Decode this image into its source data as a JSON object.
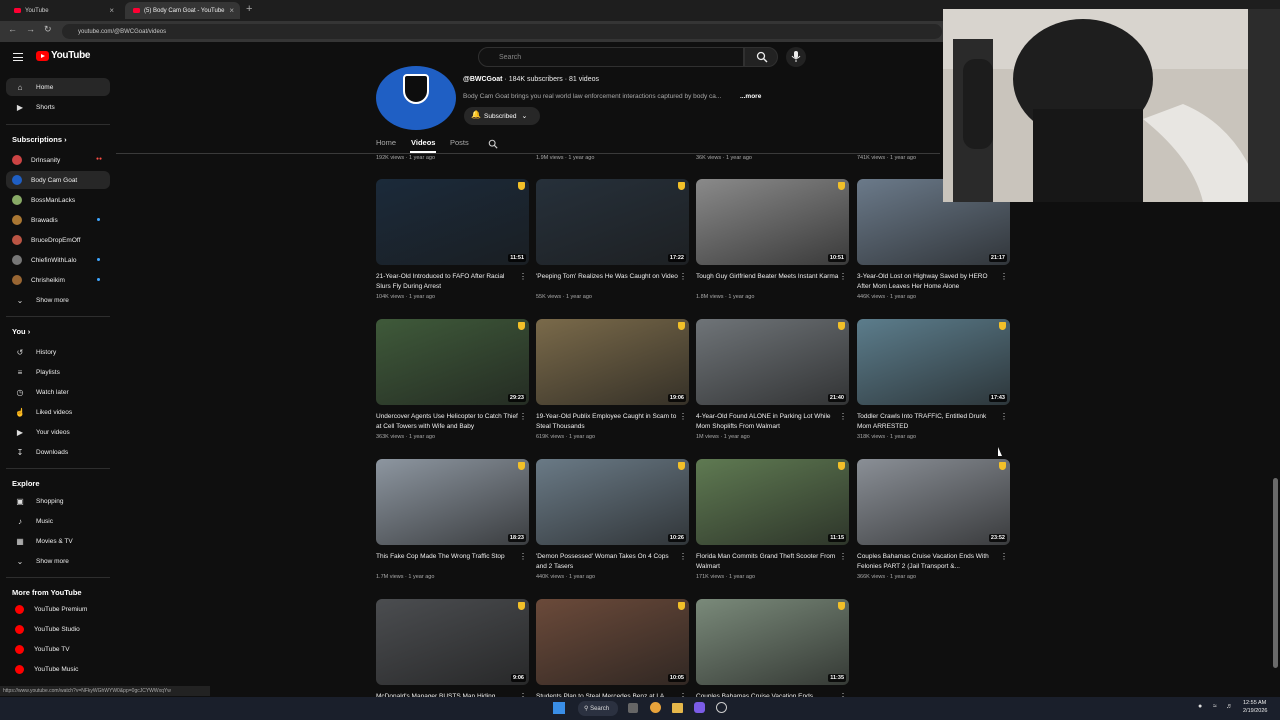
{
  "browser": {
    "tabs": [
      {
        "label": "YouTube",
        "close": "×"
      },
      {
        "label": "(5) Body Cam Goat - YouTube",
        "close": "×"
      }
    ],
    "new_tab": "+",
    "url": "youtube.com/@BWCGoat/videos",
    "status_url": "https://www.youtube.com/watch?v=NFkyWGhWYW0&pp=0gcJCYWWxqYw"
  },
  "header": {
    "logo": "YouTube",
    "search_placeholder": "Search"
  },
  "sidebar": {
    "main": [
      {
        "label": "Home",
        "icon": "home-icon"
      },
      {
        "label": "Shorts",
        "icon": "shorts-icon"
      }
    ],
    "subscriptions_title": "Subscriptions",
    "subscriptions": [
      {
        "label": "DrInsanity",
        "color": "#c44",
        "badge": "live"
      },
      {
        "label": "Body Cam Goat",
        "color": "#1f5fc4",
        "badge": "",
        "active": true
      },
      {
        "label": "BossManLacks",
        "color": "#8a6",
        "badge": ""
      },
      {
        "label": "Brawadis",
        "color": "#a73",
        "badge": "dot"
      },
      {
        "label": "BruceDropEmOff",
        "color": "#b54",
        "badge": ""
      },
      {
        "label": "ChiefinWithLalo",
        "color": "#777",
        "badge": "dot"
      },
      {
        "label": "Chrisheikim",
        "color": "#963",
        "badge": "dot"
      }
    ],
    "show_more": "Show more",
    "you_title": "You",
    "you": [
      {
        "label": "History",
        "icon": "history-icon"
      },
      {
        "label": "Playlists",
        "icon": "playlists-icon"
      },
      {
        "label": "Watch later",
        "icon": "watch-later-icon"
      },
      {
        "label": "Liked videos",
        "icon": "liked-icon"
      },
      {
        "label": "Your videos",
        "icon": "your-videos-icon"
      },
      {
        "label": "Downloads",
        "icon": "downloads-icon"
      }
    ],
    "explore_title": "Explore",
    "explore": [
      {
        "label": "Shopping",
        "icon": "shopping-icon"
      },
      {
        "label": "Music",
        "icon": "music-icon"
      },
      {
        "label": "Movies & TV",
        "icon": "movies-icon"
      }
    ],
    "explore_more": "Show more",
    "more_title": "More from YouTube",
    "more": [
      {
        "label": "YouTube Premium"
      },
      {
        "label": "YouTube Studio"
      },
      {
        "label": "YouTube TV"
      },
      {
        "label": "YouTube Music"
      }
    ]
  },
  "channel": {
    "handle": "@BWCGoat",
    "stats": " · 184K subscribers · 81 videos",
    "description": "Body Cam Goat brings you real world law enforcement interactions captured by body ca...",
    "more": "...more",
    "subscribe_label": "Subscribed",
    "tabs": [
      "Home",
      "Videos",
      "Posts"
    ]
  },
  "top_row_meta": [
    "192K views · 1 year ago",
    "1.9M views · 1 year ago",
    "36K views · 1 year ago",
    "741K views · 1 year ago"
  ],
  "videos": [
    {
      "title": "21-Year-Old Introduced to FAFO After Racial Slurs Fly During Arrest",
      "meta": "104K views · 1 year ago",
      "duration": "11:51",
      "bg": "#1b2a3a"
    },
    {
      "title": "'Peeping Tom' Realizes He Was Caught on Video",
      "meta": "55K views · 1 year ago",
      "duration": "17:22",
      "bg": "#26303a"
    },
    {
      "title": "Tough Guy Girlfriend Beater Meets Instant Karma",
      "meta": "1.8M views · 1 year ago",
      "duration": "10:51",
      "bg": "#8a8a8a"
    },
    {
      "title": "3-Year-Old Lost on Highway Saved by HERO After Mom Leaves Her Home Alone",
      "meta": "446K views · 1 year ago",
      "duration": "21:17",
      "bg": "#6b7a8a"
    },
    {
      "title": "Undercover Agents Use Helicopter to Catch Thief at Cell Towers with Wife and Baby",
      "meta": "363K views · 1 year ago",
      "duration": "29:23",
      "bg": "#3f5a3a"
    },
    {
      "title": "19-Year-Old Publix Employee Caught in Scam to Steal Thousands",
      "meta": "619K views · 1 year ago",
      "duration": "19:06",
      "bg": "#7a6a4a"
    },
    {
      "title": "4-Year-Old Found ALONE in Parking Lot While Mom Shoplifts From Walmart",
      "meta": "1M views · 1 year ago",
      "duration": "21:40",
      "bg": "#6f7478"
    },
    {
      "title": "Toddler Crawls Into TRAFFIC, Entitled Drunk Mom ARRESTED",
      "meta": "318K views · 1 year ago",
      "duration": "17:43",
      "bg": "#5c7d8c"
    },
    {
      "title": "This Fake Cop Made The Wrong Traffic Stop",
      "meta": "1.7M views · 1 year ago",
      "duration": "18:23",
      "bg": "#8d96a0"
    },
    {
      "title": "'Demon Possessed' Woman Takes On 4 Cops and 2 Tasers",
      "meta": "440K views · 1 year ago",
      "duration": "10:26",
      "bg": "#6a7a86"
    },
    {
      "title": "Florida Man Commits Grand Theft Scooter From Walmart",
      "meta": "171K views · 1 year ago",
      "duration": "11:15",
      "bg": "#5f7a52"
    },
    {
      "title": "Couples Bahamas Cruise Vacation Ends With Felonies PART 2 (Jail Transport &...",
      "meta": "366K views · 1 year ago",
      "duration": "23:52",
      "bg": "#8a8f96"
    },
    {
      "title": "McDonald's Manager BUSTS Man Hiding...",
      "meta": "",
      "duration": "9:06",
      "bg": "#4b4d50"
    },
    {
      "title": "Students Plan to Steal Mercedes Benz at LA...",
      "meta": "",
      "duration": "10:05",
      "bg": "#6b4a3a"
    },
    {
      "title": "Couples Bahamas Cruise Vacation Ends...",
      "meta": "",
      "duration": "11:35",
      "bg": "#7a8a7a"
    }
  ],
  "taskbar": {
    "search": "Search",
    "time": "12:55 AM",
    "date": "2/19/2026"
  }
}
